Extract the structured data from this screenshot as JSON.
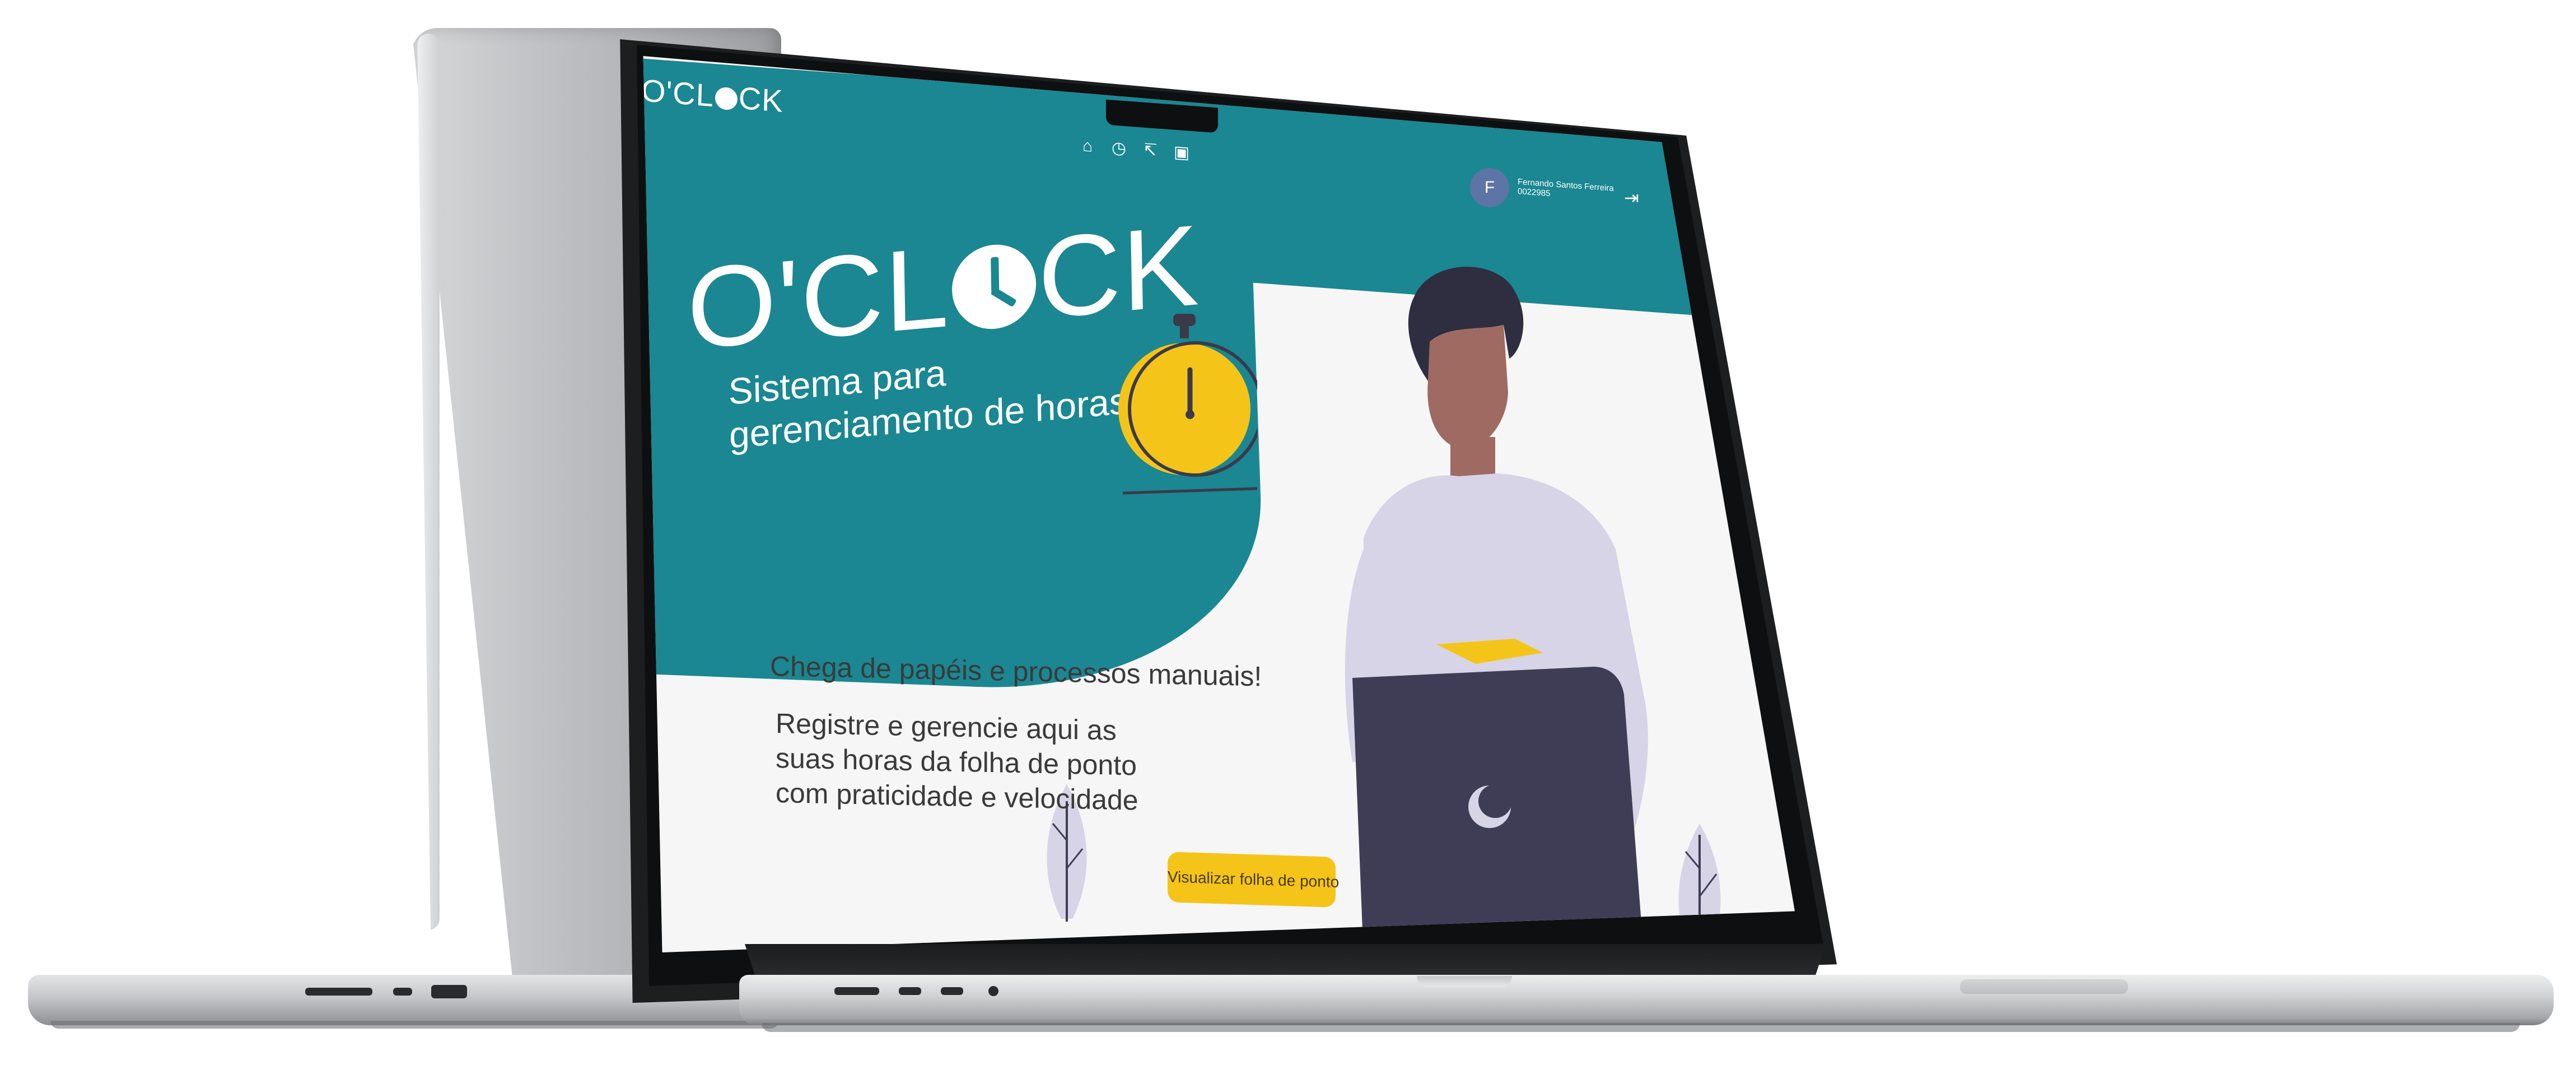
{
  "app": {
    "brand": "O'CLOCK",
    "brand_accent_color": "#1a8792",
    "cta_color": "#f5c418"
  },
  "header": {
    "logo_text_before": "O'CL",
    "logo_text_after": "CK",
    "nav_icons": [
      "home-icon",
      "clock-icon",
      "history-icon",
      "calendar-icon"
    ],
    "user": {
      "avatar_initial": "F",
      "name": "Fernando Santos Ferreira",
      "id": "0022985"
    },
    "logout_icon": "logout-icon"
  },
  "hero": {
    "title_before": "O'CL",
    "title_after": "CK",
    "subtitle": "Sistema para gerenciamento de horas"
  },
  "content": {
    "tagline_1": "Chega de papéis e processos manuais!",
    "tagline_2": "Registre e gerencie aqui as suas horas da folha de ponto com praticidade e velocidade",
    "cta_label": "Visualizar folha de ponto"
  }
}
